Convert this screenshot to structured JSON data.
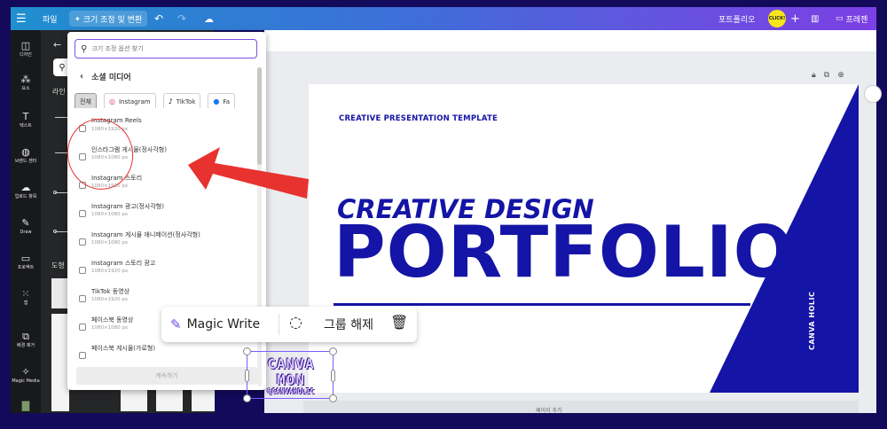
{
  "topbar": {
    "menu_icon": "hamburger-icon",
    "file": "파일",
    "resize": "크기 조정 및 변환",
    "portfolio": "포트폴리오",
    "avatar": "CLICK!",
    "present": "프레젠"
  },
  "rail": [
    {
      "label": "디자인",
      "icon": "layout-icon"
    },
    {
      "label": "요소",
      "icon": "elements-icon"
    },
    {
      "label": "텍스트",
      "icon": "text-icon"
    },
    {
      "label": "브랜드 센터",
      "icon": "brand-icon"
    },
    {
      "label": "업로드 항목",
      "icon": "cloud-upload-icon"
    },
    {
      "label": "Draw",
      "icon": "draw-icon"
    },
    {
      "label": "프로젝트",
      "icon": "folder-icon"
    },
    {
      "label": "앱",
      "icon": "apps-icon"
    },
    {
      "label": "배경 제거",
      "icon": "bg-remove-icon"
    },
    {
      "label": "Magic Media",
      "icon": "magic-media-icon"
    }
  ],
  "panel": {
    "label_lines": "라인",
    "label_shapes": "도형"
  },
  "dropdown": {
    "search_placeholder": "크기 조정 옵션 찾기",
    "section": "소셜 미디어",
    "chips": [
      {
        "label": "전체",
        "icon": ""
      },
      {
        "label": "Instagram",
        "icon": "instagram-icon"
      },
      {
        "label": "TikTok",
        "icon": "tiktok-icon"
      },
      {
        "label": "Fa",
        "icon": "facebook-icon"
      }
    ],
    "items": [
      {
        "name": "Instagram Reels",
        "size": "1080×1920 px"
      },
      {
        "name": "인스타그램 게시물(정사각형)",
        "size": "1080×1080 px"
      },
      {
        "name": "Instagram 스토리",
        "size": "1080×1920 px"
      },
      {
        "name": "Instagram 광고(정사각형)",
        "size": "1080×1080 px"
      },
      {
        "name": "Instagram 게시물 애니메이션(정사각형)",
        "size": "1080×1080 px"
      },
      {
        "name": "Instagram 스토리 광고",
        "size": "1080×1920 px"
      },
      {
        "name": "TikTok 동영상",
        "size": "1080×1920 px"
      },
      {
        "name": "페이스북 동영상",
        "size": "1080×1080 px"
      },
      {
        "name": "페이스북 게시물(가로형)",
        "size": ""
      }
    ],
    "continue": "계속하기"
  },
  "slide": {
    "tag": "CREATIVE PRESENTATION TEMPLATE",
    "subtitle": "CREATIVE DESIGN",
    "title": "PORTFOLIO",
    "vertical_text": "CANVA HOLIC",
    "colors": {
      "primary": "#1414a6",
      "background": "#ffffff"
    }
  },
  "workspace": {
    "add_page": "페이지 추가"
  },
  "float_toolbar": {
    "magic_write": "Magic Write",
    "ungroup": "그룹 해제"
  },
  "sticker": {
    "line1": "CANVA",
    "line2": "MON",
    "line3": "@CANVAHOLIC"
  },
  "annotation": {
    "color": "#e8322f"
  }
}
